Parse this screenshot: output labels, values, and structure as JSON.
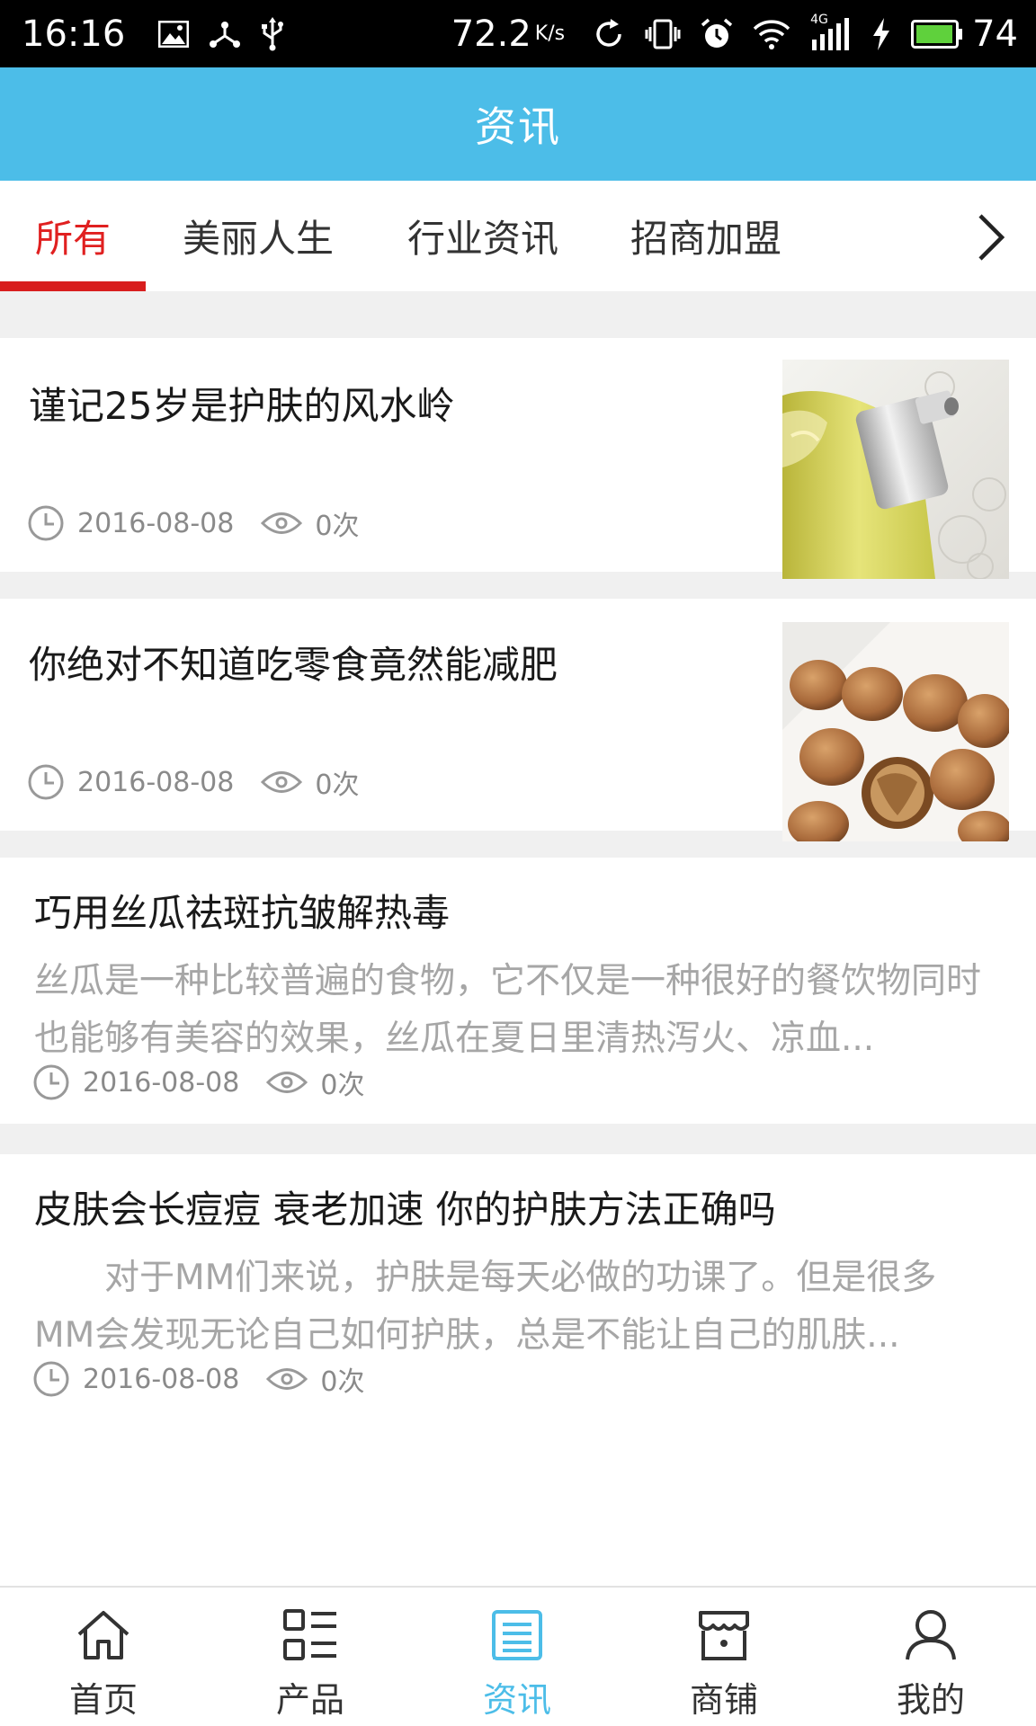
{
  "status_bar": {
    "time": "16:16",
    "network_speed": "72.2",
    "speed_unit": "K/s",
    "network_type": "4G",
    "battery_level": "74",
    "icons": [
      "image-icon",
      "usb-debug-icon",
      "usb-icon",
      "sync-icon",
      "vibrate-icon",
      "alarm-icon",
      "wifi-icon",
      "signal-icon",
      "charging-icon",
      "battery-icon"
    ]
  },
  "header": {
    "title": "资讯"
  },
  "tabs": {
    "items": [
      {
        "label": "所有",
        "active": true
      },
      {
        "label": "美丽人生",
        "active": false
      },
      {
        "label": "行业资讯",
        "active": false
      },
      {
        "label": "招商加盟",
        "active": false
      }
    ],
    "more_icon": "chevron-right-icon"
  },
  "colors": {
    "header_bg": "#4cbde8",
    "active_tab": "#e02020",
    "active_nav": "#4cbde8",
    "list_bg": "#f0f0f0"
  },
  "articles": [
    {
      "title": "谨记25岁是护肤的风水岭",
      "date": "2016-08-08",
      "views": "0次",
      "has_image": true,
      "image": "perfume-bottle"
    },
    {
      "title": "你绝对不知道吃零食竟然能减肥",
      "date": "2016-08-08",
      "views": "0次",
      "has_image": true,
      "image": "walnuts"
    },
    {
      "title": "巧用丝瓜祛斑抗皱解热毒",
      "summary": "丝瓜是一种比较普遍的食物，它不仅是一种很好的餐饮物同时也能够有美容的效果，丝瓜在夏日里清热泻火、凉血...",
      "date": "2016-08-08",
      "views": "0次",
      "has_image": false
    },
    {
      "title": "皮肤会长痘痘 衰老加速 你的护肤方法正确吗",
      "summary": "　　对于MM们来说，护肤是每天必做的功课了。但是很多MM会发现无论自己如何护肤，总是不能让自己的肌肤...",
      "date": "2016-08-08",
      "views": "0次",
      "has_image": false
    }
  ],
  "bottom_nav": {
    "items": [
      {
        "label": "首页",
        "icon": "home-icon",
        "active": false
      },
      {
        "label": "产品",
        "icon": "product-list-icon",
        "active": false
      },
      {
        "label": "资讯",
        "icon": "news-icon",
        "active": true
      },
      {
        "label": "商铺",
        "icon": "shop-icon",
        "active": false
      },
      {
        "label": "我的",
        "icon": "user-icon",
        "active": false
      }
    ]
  }
}
